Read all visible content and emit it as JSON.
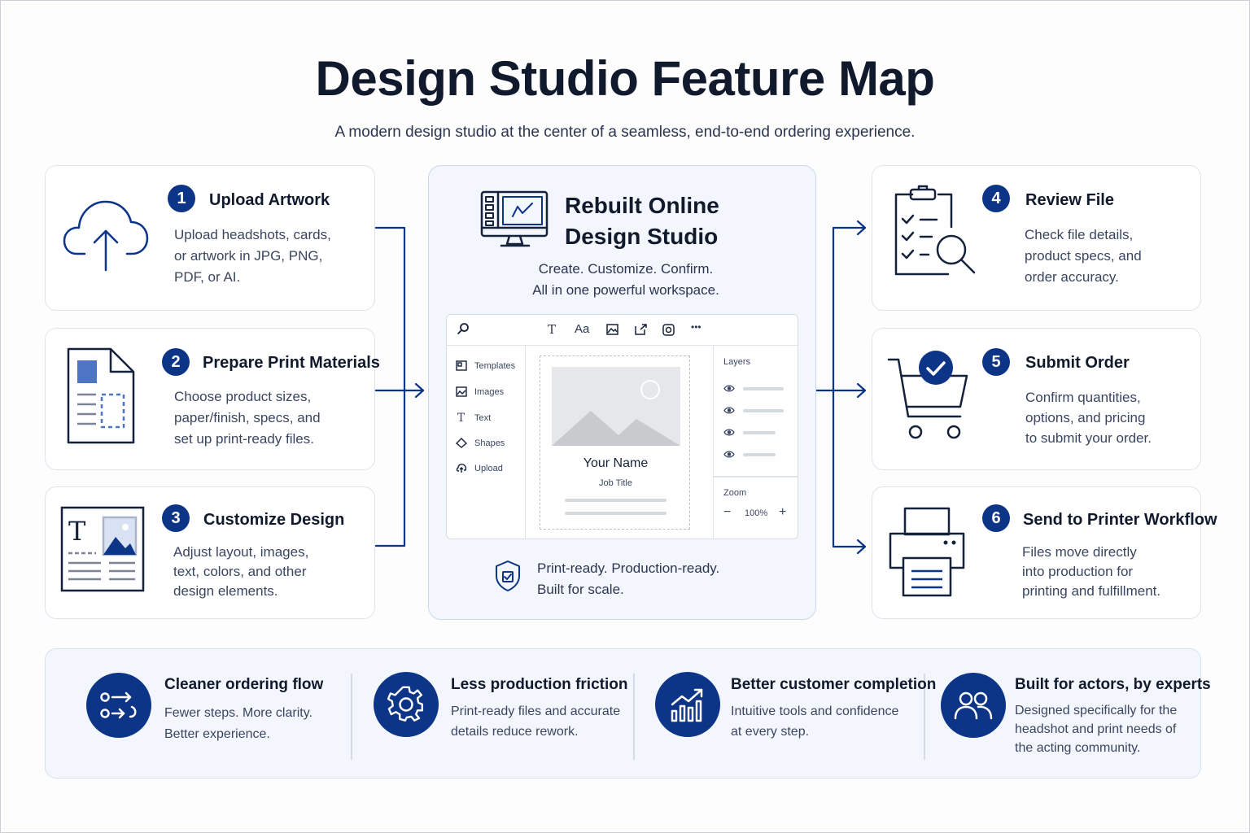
{
  "header": {
    "title": "Design Studio Feature Map",
    "subtitle": "A modern design studio at the center of a seamless, end-to-end ordering experience."
  },
  "colors": {
    "brand": "#0c3487",
    "text": "#111a2c",
    "panel": "#f3f7fd"
  },
  "steps": [
    {
      "number": "1",
      "title": "Upload Artwork",
      "description": "Upload headshots, cards,\nor artwork in JPG, PNG,\nPDF, or AI.",
      "icon": "cloud-upload-icon"
    },
    {
      "number": "2",
      "title": "Prepare Print Materials",
      "description": "Choose product sizes,\npaper/finish, specs, and\nset up print-ready files.",
      "icon": "document-icon"
    },
    {
      "number": "3",
      "title": "Customize Design",
      "description": "Adjust layout, images,\ntext, colors, and other\ndesign elements.",
      "icon": "layout-editor-icon"
    },
    {
      "number": "4",
      "title": "Review File",
      "description": "Check file details,\nproduct specs, and\norder accuracy.",
      "icon": "clipboard-search-icon"
    },
    {
      "number": "5",
      "title": "Submit Order",
      "description": "Confirm quantities,\noptions, and pricing\nto submit your order.",
      "icon": "cart-check-icon"
    },
    {
      "number": "6",
      "title": "Send to Printer Workflow",
      "description": "Files move directly\ninto production for\nprinting and fulfillment.",
      "icon": "printer-icon"
    }
  ],
  "studio": {
    "title": "Rebuilt Online\nDesign Studio",
    "subtitle": "Create. Customize. Confirm.\nAll in one powerful workspace.",
    "toolbar": {
      "text_tool": "T",
      "font_tool": "Aa",
      "more": "•••"
    },
    "sidebar": [
      "Templates",
      "Images",
      "Text",
      "Shapes",
      "Upload"
    ],
    "canvas": {
      "name": "Your Name",
      "job_title": "Job Title"
    },
    "layers_label": "Layers",
    "zoom_label": "Zoom",
    "zoom_value": "100%",
    "zoom_minus": "−",
    "zoom_plus": "+",
    "footer": "Print-ready. Production-ready.\nBuilt for scale."
  },
  "benefits": [
    {
      "title": "Cleaner ordering flow",
      "description": "Fewer steps. More clarity.\nBetter experience.",
      "icon": "flow-arrows-icon"
    },
    {
      "title": "Less production friction",
      "description": "Print-ready files and accurate\ndetails reduce rework.",
      "icon": "gear-icon"
    },
    {
      "title": "Better customer completion",
      "description": "Intuitive tools and confidence\nat every step.",
      "icon": "growth-chart-icon"
    },
    {
      "title": "Built for actors, by experts",
      "description": "Designed specifically for the\nheadshot and print needs of\nthe acting community.",
      "icon": "users-icon"
    }
  ]
}
